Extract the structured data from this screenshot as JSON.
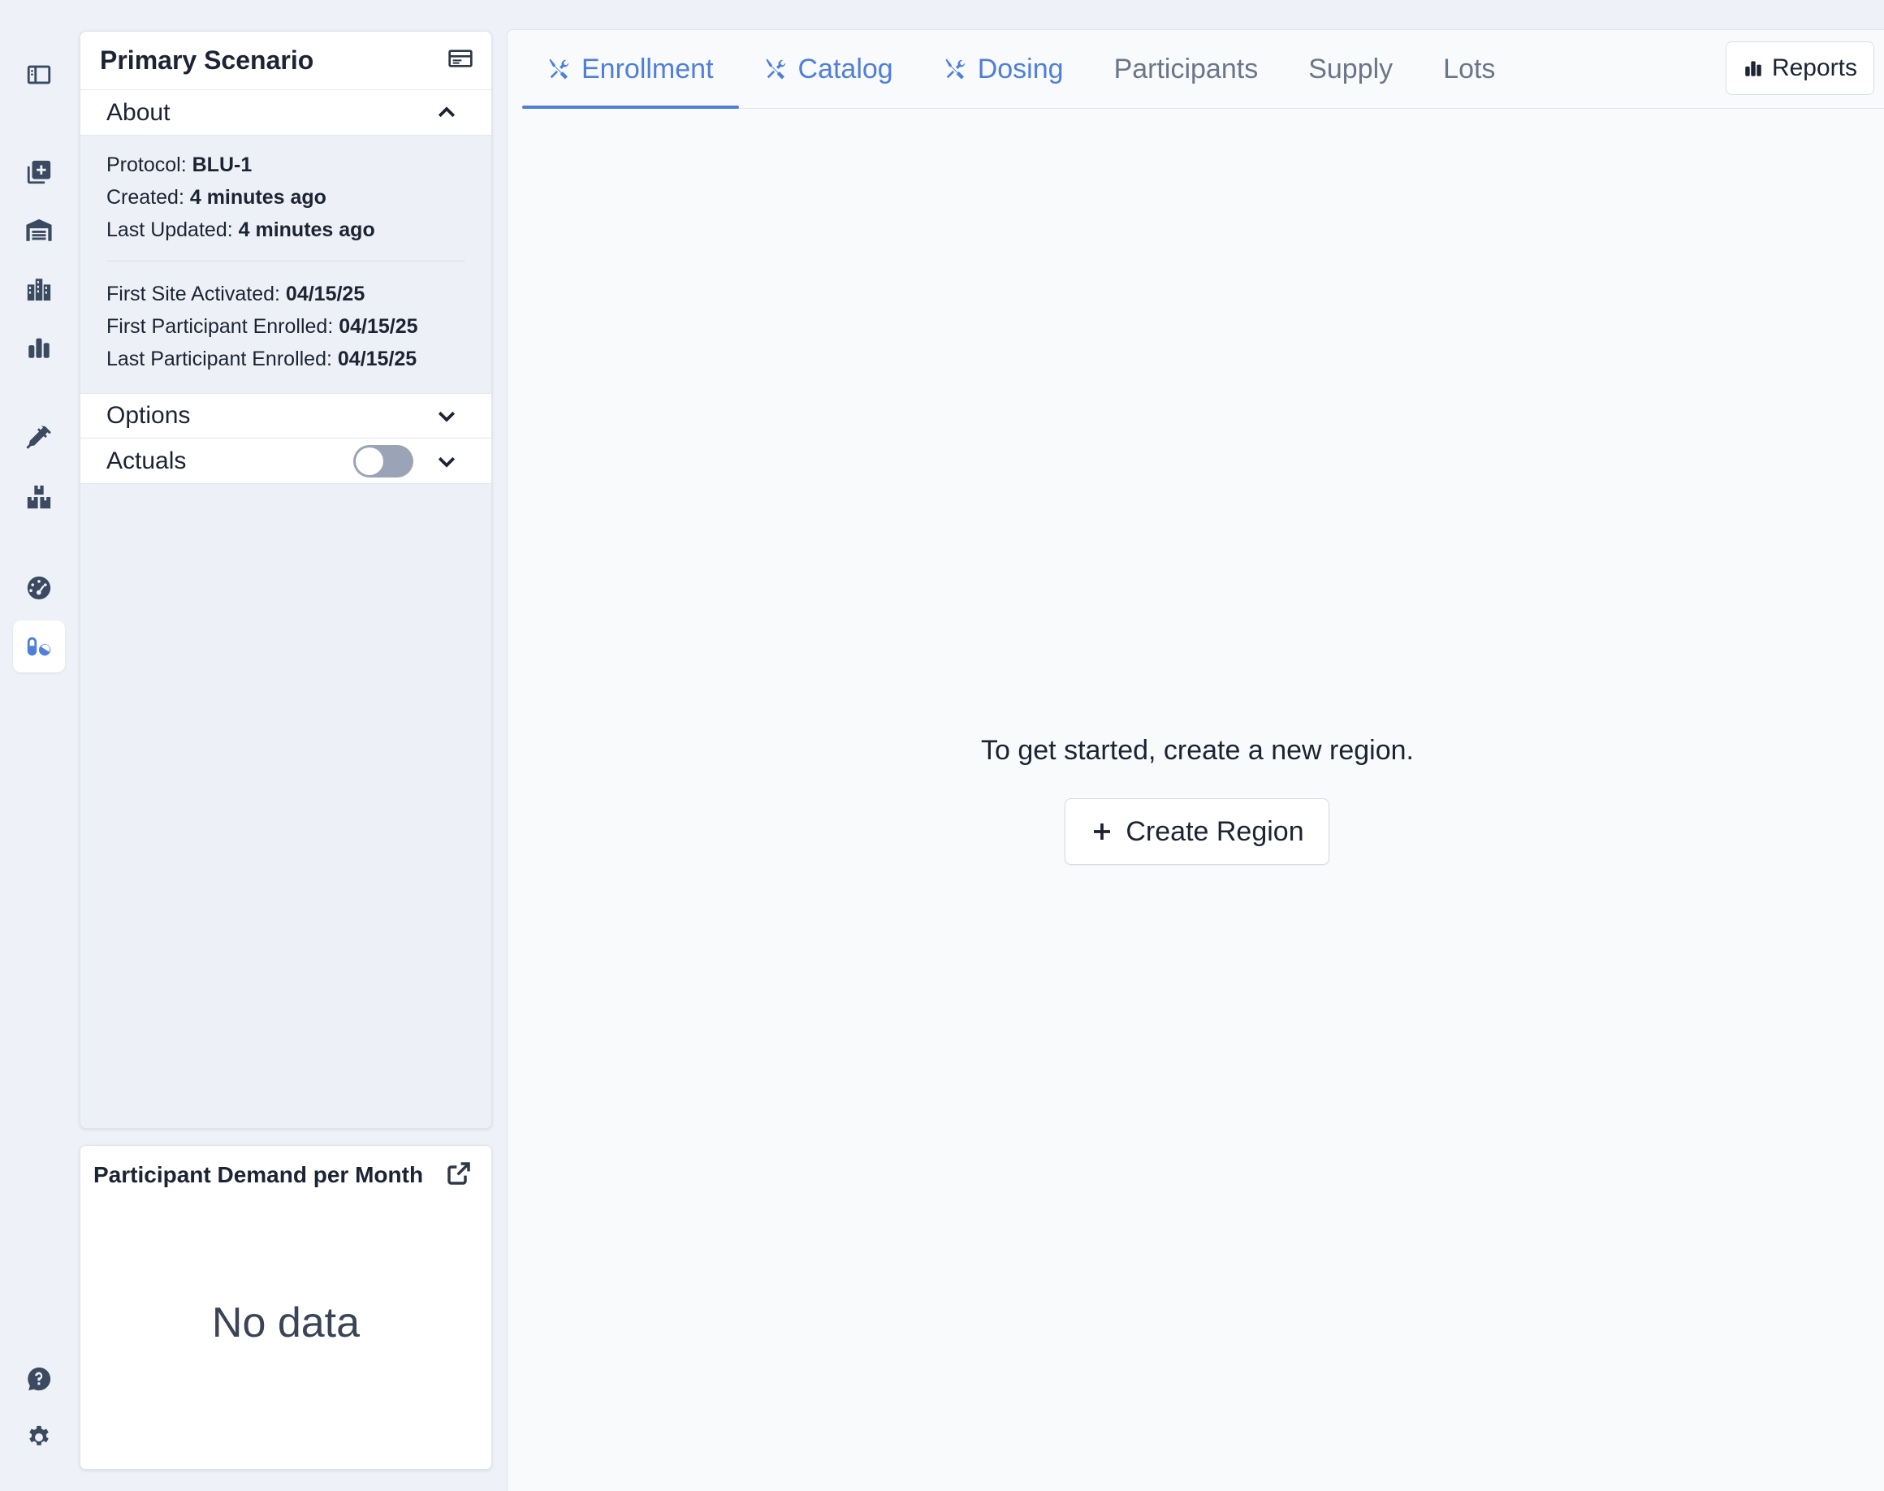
{
  "rail": {
    "items": [
      {
        "icon": "sidebar-toggle-icon"
      },
      {
        "icon": "add-scenario-icon"
      },
      {
        "icon": "warehouse-icon"
      },
      {
        "icon": "sites-icon"
      },
      {
        "icon": "bar-chart-icon"
      },
      {
        "icon": "syringe-icon"
      },
      {
        "icon": "boxes-icon"
      },
      {
        "icon": "dashboard-gauge-icon"
      },
      {
        "icon": "pills-icon",
        "active": true
      },
      {
        "icon": "help-icon"
      },
      {
        "icon": "settings-gear-icon"
      }
    ]
  },
  "scenario": {
    "title": "Primary Scenario",
    "about_label": "About",
    "protocol_label": "Protocol:",
    "protocol_value": "BLU-1",
    "created_label": "Created:",
    "created_value": "4 minutes ago",
    "updated_label": "Last Updated:",
    "updated_value": "4 minutes ago",
    "first_site_label": "First Site Activated:",
    "first_site_value": "04/15/25",
    "first_enrolled_label": "First Participant Enrolled:",
    "first_enrolled_value": "04/15/25",
    "last_enrolled_label": "Last Participant Enrolled:",
    "last_enrolled_value": "04/15/25",
    "options_label": "Options",
    "actuals_label": "Actuals",
    "actuals_enabled": false
  },
  "demand": {
    "title": "Participant Demand per Month",
    "empty_text": "No data"
  },
  "tabs": [
    {
      "label": "Enrollment",
      "icon": "tools-icon",
      "accent": true,
      "active": true
    },
    {
      "label": "Catalog",
      "icon": "tools-icon",
      "accent": true
    },
    {
      "label": "Dosing",
      "icon": "tools-icon",
      "accent": true
    },
    {
      "label": "Participants"
    },
    {
      "label": "Supply"
    },
    {
      "label": "Lots"
    }
  ],
  "reports_label": "Reports",
  "main": {
    "empty_message": "To get started, create a new region.",
    "create_label": "Create Region"
  },
  "colors": {
    "accent": "#4f7fd9",
    "background": "#eef2f8"
  }
}
